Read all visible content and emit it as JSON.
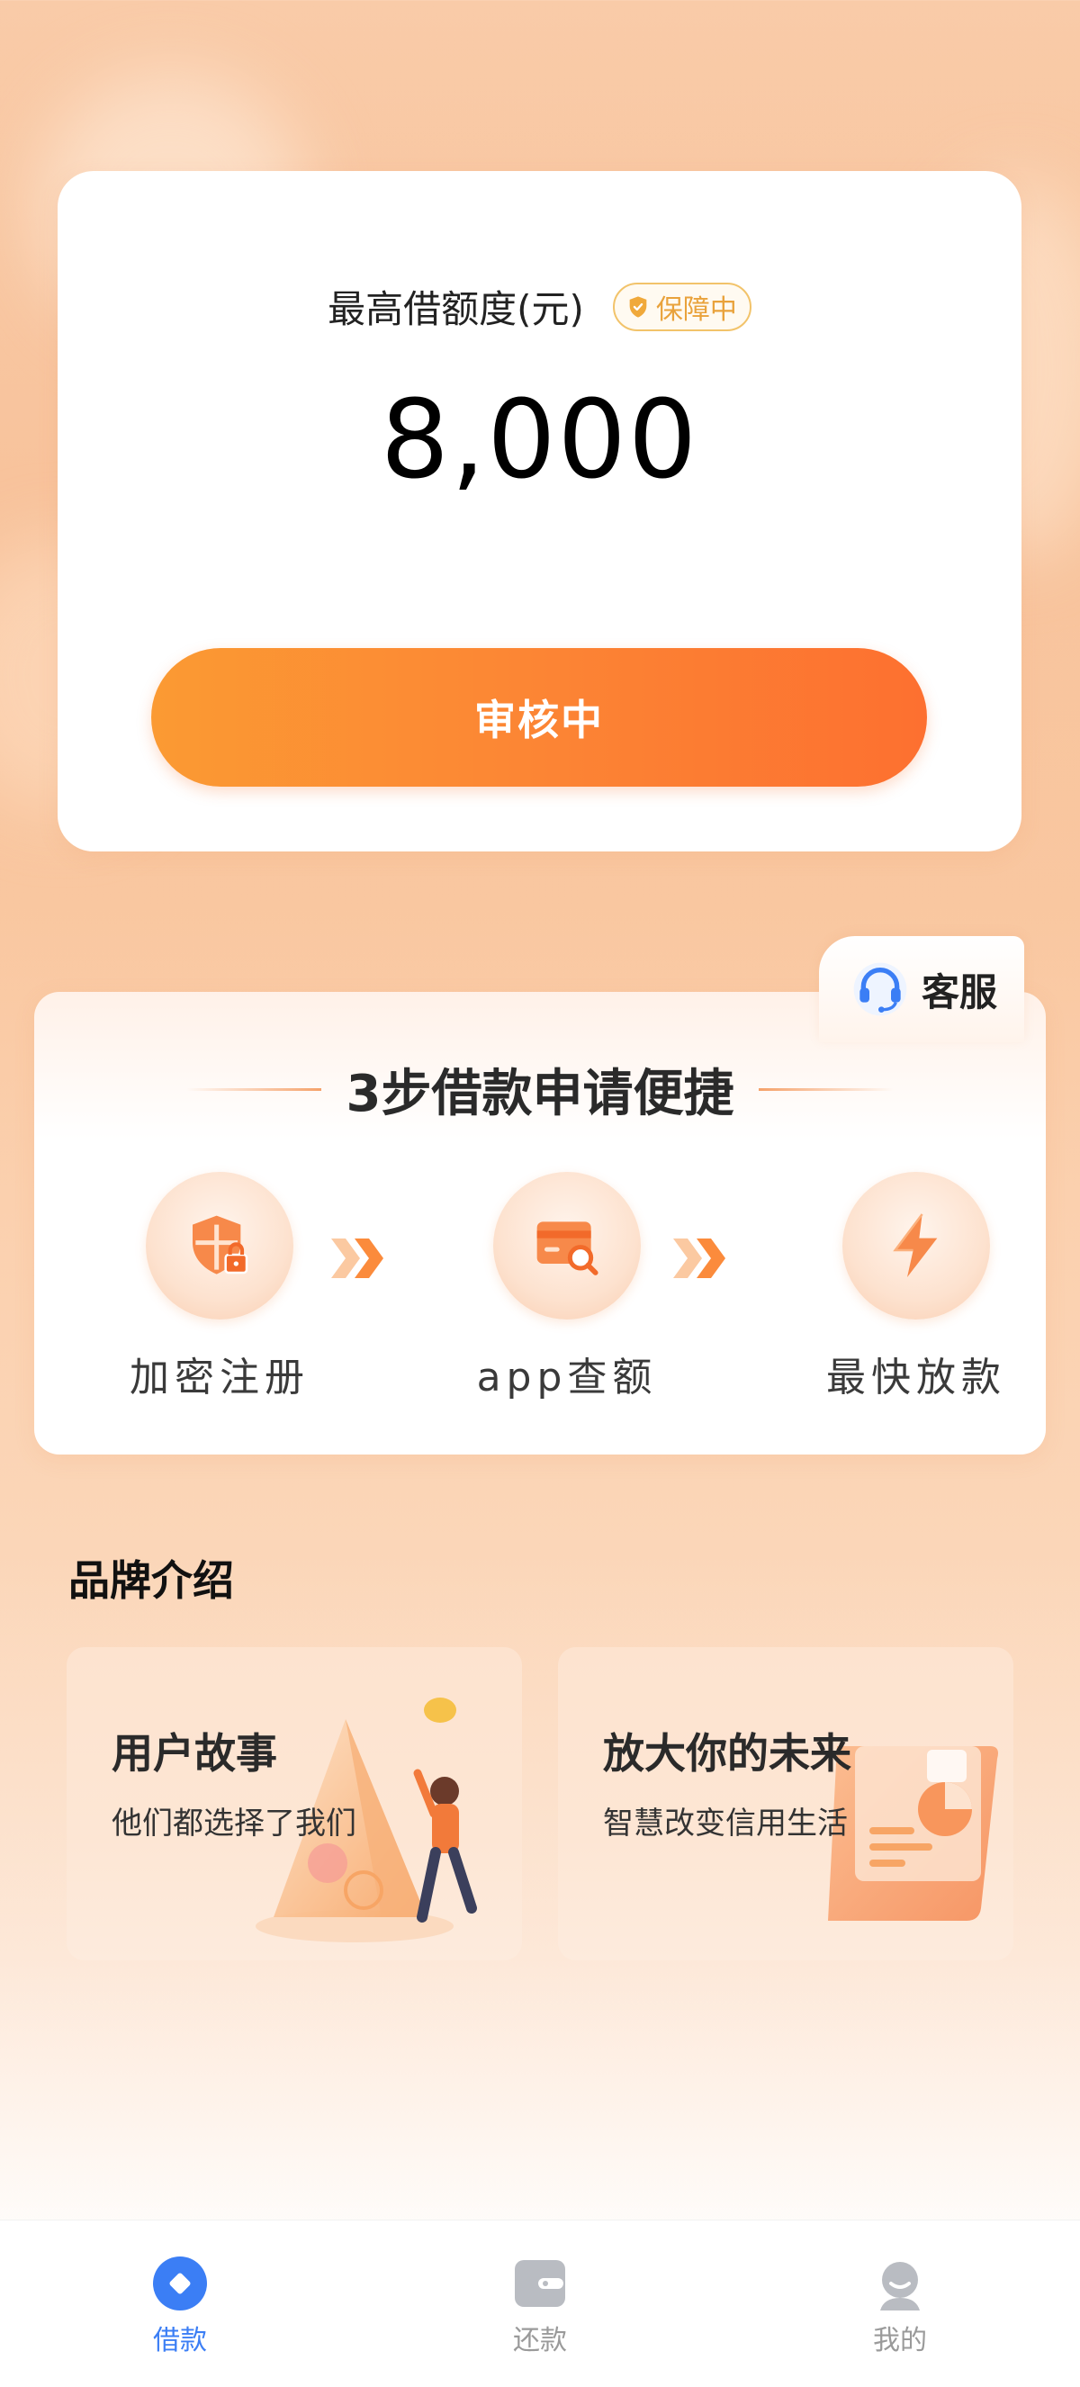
{
  "quota": {
    "label": "最高借额度(元)",
    "badge": "保障中",
    "amount": "8,000",
    "button": "审核中"
  },
  "customer_service": {
    "label": "客服",
    "icon": "headset-icon"
  },
  "steps": {
    "title": "3步借款申请便捷",
    "items": [
      {
        "label": "加密注册",
        "icon": "shield-lock-icon"
      },
      {
        "label": "app查额",
        "icon": "card-search-icon"
      },
      {
        "label": "最快放款",
        "icon": "lightning-icon"
      }
    ]
  },
  "brand": {
    "title": "品牌介绍",
    "cards": [
      {
        "title": "用户故事",
        "subtitle": "他们都选择了我们"
      },
      {
        "title": "放大你的未来",
        "subtitle": "智慧改变信用生活"
      }
    ]
  },
  "tabbar": {
    "items": [
      {
        "label": "借款",
        "icon": "loan-icon",
        "active": true
      },
      {
        "label": "还款",
        "icon": "wallet-icon",
        "active": false
      },
      {
        "label": "我的",
        "icon": "user-icon",
        "active": false
      }
    ]
  },
  "colors": {
    "accent": "#fd7d32",
    "active_tab": "#3b7ef5",
    "badge": "#e9a23b"
  }
}
